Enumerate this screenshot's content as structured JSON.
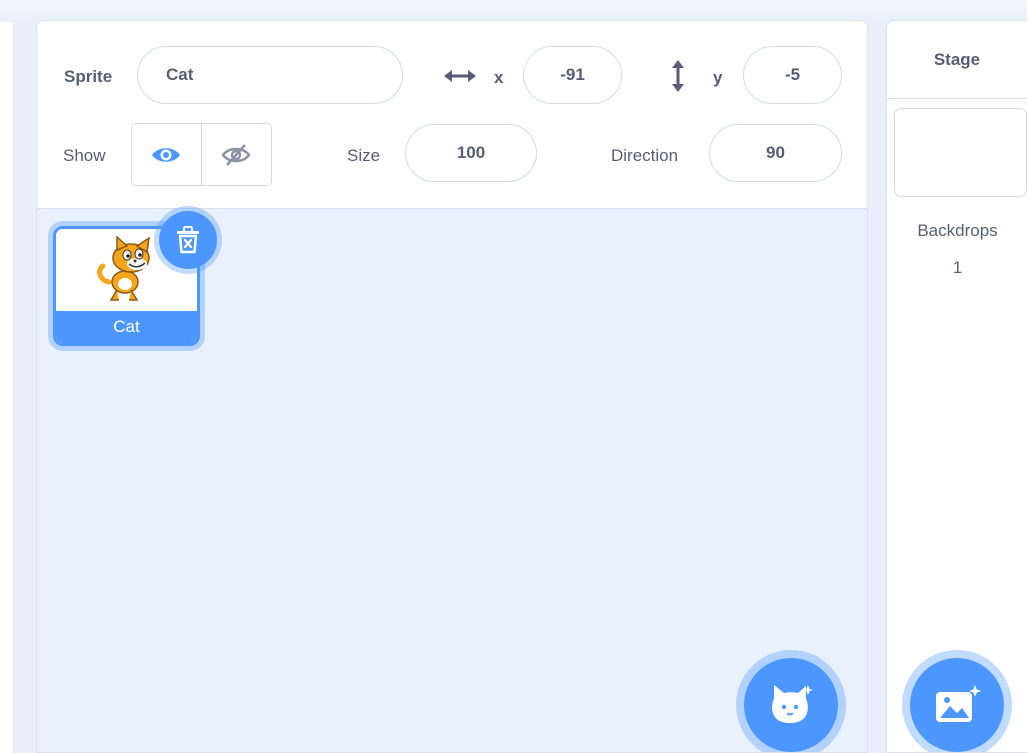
{
  "sprite_info": {
    "sprite_label": "Sprite",
    "sprite_name": "Cat",
    "x_label": "x",
    "x_value": "-91",
    "y_label": "y",
    "y_value": "-5",
    "show_label": "Show",
    "size_label": "Size",
    "size_value": "100",
    "direction_label": "Direction",
    "direction_value": "90",
    "show_state": "visible"
  },
  "sprites": [
    {
      "name": "Cat",
      "selected": true,
      "icon": "cat-costume"
    }
  ],
  "buttons": {
    "add_sprite_icon": "cat-add-icon",
    "add_backdrop_icon": "image-add-icon",
    "delete_icon": "trash-icon"
  },
  "stage": {
    "header": "Stage",
    "backdrops_label": "Backdrops",
    "backdrops_count": "1"
  },
  "colors": {
    "accent": "#4c97ff",
    "text": "#575e75",
    "pane_bg": "#e9f1fc"
  }
}
